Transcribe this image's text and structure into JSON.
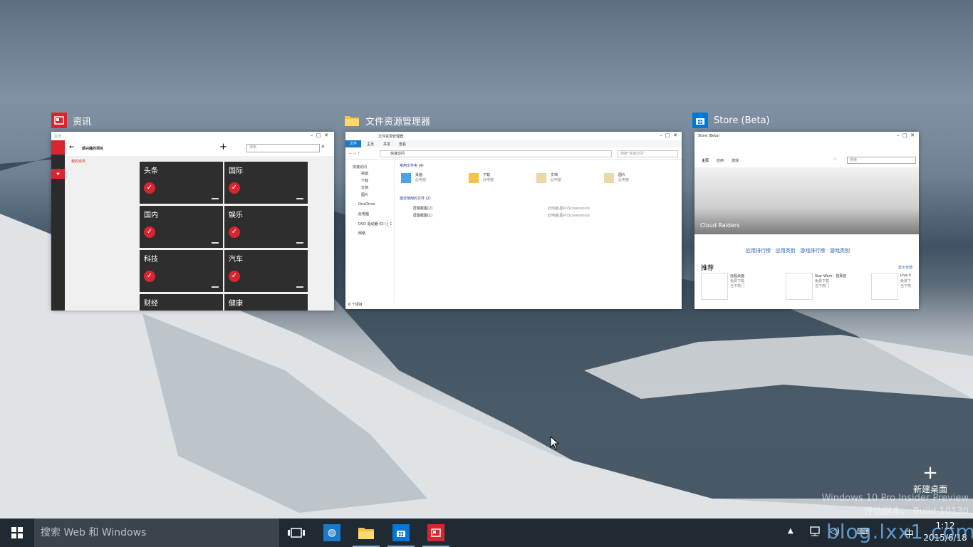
{
  "windows": [
    {
      "title": "资讯",
      "app": {
        "titlebar_text": "资讯",
        "header": "感兴趣的项目",
        "side_link": "我的资讯",
        "search_placeholder": "搜索",
        "tiles": [
          "头条",
          "国际",
          "国内",
          "娱乐",
          "科技",
          "汽车",
          "财经",
          "健康"
        ]
      }
    },
    {
      "title": "文件资源管理器",
      "app": {
        "titlebar_text": "文件资源管理器",
        "ribbon_tabs": [
          "文件",
          "主页",
          "共享",
          "查看"
        ],
        "address": "快速访问",
        "search_placeholder": "搜索\"快速访问\"",
        "nav_items": [
          "快速访问",
          "桌面",
          "下载",
          "文档",
          "图片",
          "OneDrive",
          "此电脑",
          "DVD 驱动器 (D:) J_C",
          "网络"
        ],
        "frequent_header": "常用文件夹 (4)",
        "folders": [
          {
            "name": "桌面",
            "sub": "此电脑"
          },
          {
            "name": "下载",
            "sub": "此电脑"
          },
          {
            "name": "文档",
            "sub": "此电脑"
          },
          {
            "name": "图片",
            "sub": "此电脑"
          }
        ],
        "recent_header": "最近使用的文件 (2)",
        "recent_files": [
          {
            "name": "屏幕截图(2)",
            "path": "此电脑\\图片\\Screenshots"
          },
          {
            "name": "屏幕截图(1)",
            "path": "此电脑\\图片\\Screenshots"
          }
        ],
        "status": "6 个项目"
      }
    },
    {
      "title": "Store (Beta)",
      "app": {
        "titlebar_text": "Store (Beta)",
        "nav": [
          "主页",
          "应用",
          "游戏"
        ],
        "search_placeholder": "搜索",
        "hero_caption": "Cloud Raiders",
        "links": [
          "应用排行榜",
          "应用类别",
          "游戏排行榜",
          "游戏类别"
        ],
        "recommend": "推荐",
        "show_all": "显示全部",
        "items": [
          {
            "name": "远程桌面",
            "price": "免费下载",
            "tag": "当下热门"
          },
          {
            "name": "Star Wars：指挥官",
            "price": "免费下载",
            "tag": "当下热门"
          },
          {
            "name": "Live Ir",
            "price": "免费下",
            "tag": "当下热"
          }
        ]
      }
    }
  ],
  "new_desktop": {
    "label": "新建桌面"
  },
  "watermark": {
    "line1": "Windows 10 Pro Insider Preview",
    "line2": "评估副本。 Build 10130"
  },
  "taskbar": {
    "search_placeholder": "搜索 Web 和 Windows",
    "time": "1:12",
    "date": "2015/6/18",
    "ime": "中",
    "overlay": "blog.lxx1.com"
  },
  "colors": {
    "news_red": "#d9252f",
    "explorer_blue": "#1979ca",
    "store_blue": "#0078d7",
    "taskbar": "#1f2a33"
  }
}
